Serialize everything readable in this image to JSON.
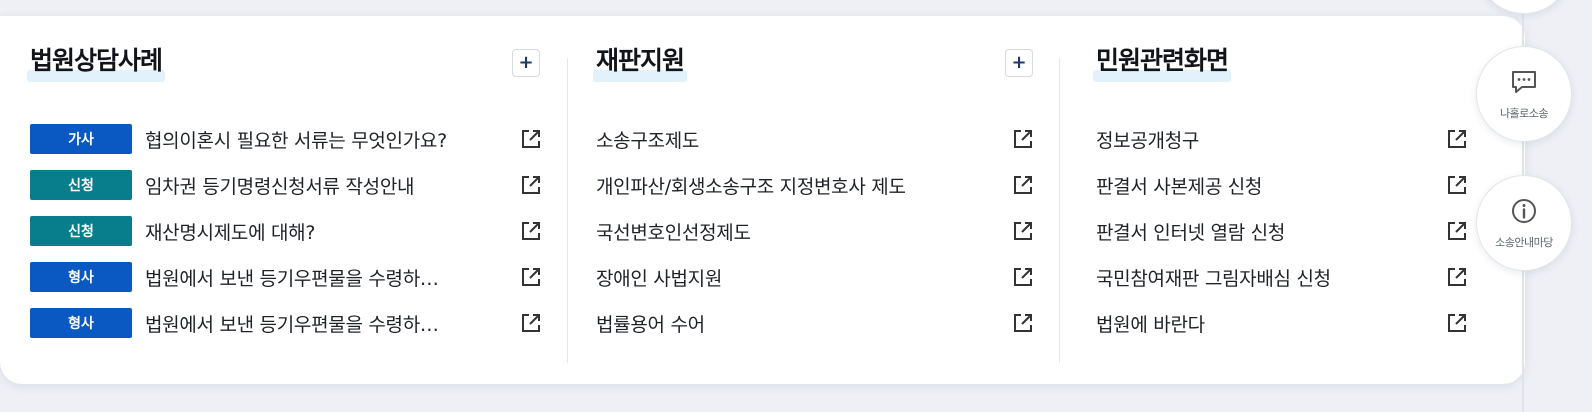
{
  "colors": {
    "tag_blue": "#0a58c2",
    "tag_teal": "#087d8c",
    "title_highlight": "#e2f1fb"
  },
  "sections": [
    {
      "title": "법원상담사례",
      "plus_label": "+",
      "items": [
        {
          "tag": "가사",
          "tag_color": "blue",
          "text": "협의이혼시 필요한 서류는 무엇인가요?",
          "icon": "external-link-icon"
        },
        {
          "tag": "신청",
          "tag_color": "teal",
          "text": "임차권 등기명령신청서류 작성안내",
          "icon": "external-link-icon"
        },
        {
          "tag": "신청",
          "tag_color": "teal",
          "text": "재산명시제도에 대해?",
          "icon": "external-link-icon"
        },
        {
          "tag": "형사",
          "tag_color": "blue",
          "text": "법원에서 보낸 등기우편물을 수령하…",
          "icon": "external-link-icon"
        },
        {
          "tag": "형사",
          "tag_color": "blue",
          "text": "법원에서 보낸 등기우편물을 수령하…",
          "icon": "external-link-icon"
        }
      ]
    },
    {
      "title": "재판지원",
      "plus_label": "+",
      "items": [
        {
          "text": "소송구조제도",
          "icon": "external-link-icon"
        },
        {
          "text": "개인파산/회생소송구조 지정변호사 제도",
          "icon": "external-link-icon"
        },
        {
          "text": "국선변호인선정제도",
          "icon": "external-link-icon"
        },
        {
          "text": "장애인 사법지원",
          "icon": "external-link-icon"
        },
        {
          "text": "법률용어 수어",
          "icon": "external-link-icon"
        }
      ]
    },
    {
      "title": "민원관련화면",
      "items": [
        {
          "text": "정보공개청구",
          "icon": "external-link-icon"
        },
        {
          "text": "판결서 사본제공 신청",
          "icon": "external-link-icon"
        },
        {
          "text": "판결서 인터넷 열람 신청",
          "icon": "external-link-icon"
        },
        {
          "text": "국민참여재판 그림자배심 신청",
          "icon": "external-link-icon"
        },
        {
          "text": "법원에 바란다",
          "icon": "external-link-icon"
        }
      ]
    }
  ],
  "side_rail": [
    {
      "label": "나홀로소송",
      "icon": "chat-bubble-icon"
    },
    {
      "label": "소송안내마당",
      "icon": "info-circle-icon"
    }
  ]
}
